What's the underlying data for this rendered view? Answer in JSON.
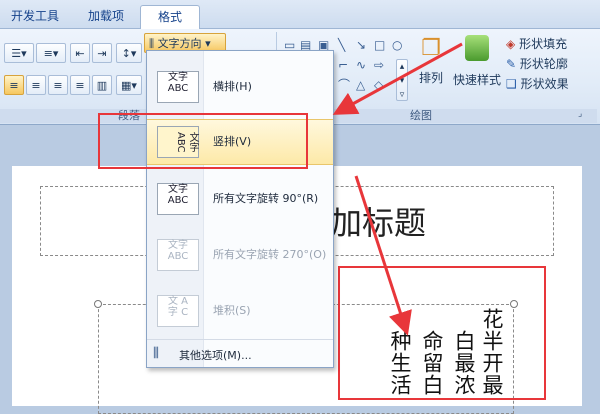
{
  "tabs": [
    "开发工具",
    "加载项",
    "格式"
  ],
  "ribbon": {
    "text_direction_label": "文字方向",
    "arrange_label": "排列",
    "quick_style_label": "快速样式",
    "shape_fill_label": "形状填充",
    "shape_outline_label": "形状轮廓",
    "shape_effect_label": "形状效果",
    "group_paragraph": "段落",
    "group_drawing": "绘图"
  },
  "menu": {
    "items": [
      {
        "label": "横排(H)",
        "icon_text": "文字 ABC",
        "state": "normal"
      },
      {
        "label": "竖排(V)",
        "icon_text": "ABC 文字",
        "state": "hover"
      },
      {
        "label": "所有文字旋转 90°(R)",
        "icon_text": "文字 ABC",
        "state": "normal"
      },
      {
        "label": "所有文字旋转 270°(O)",
        "icon_text": "文字 ABC",
        "state": "disabled"
      },
      {
        "label": "堆积(S)",
        "icon_text": "文字 ABC",
        "state": "disabled"
      }
    ],
    "more_options": "其他选项(M)..."
  },
  "slide": {
    "title": "加标题",
    "vertical_columns": [
      "花半开最",
      "白最浓",
      "命留白",
      "种生活"
    ]
  },
  "colors": {
    "highlight_red": "#e8363a",
    "ribbon_blue": "#d6e3f3",
    "menu_hover": "#fde9a8"
  }
}
